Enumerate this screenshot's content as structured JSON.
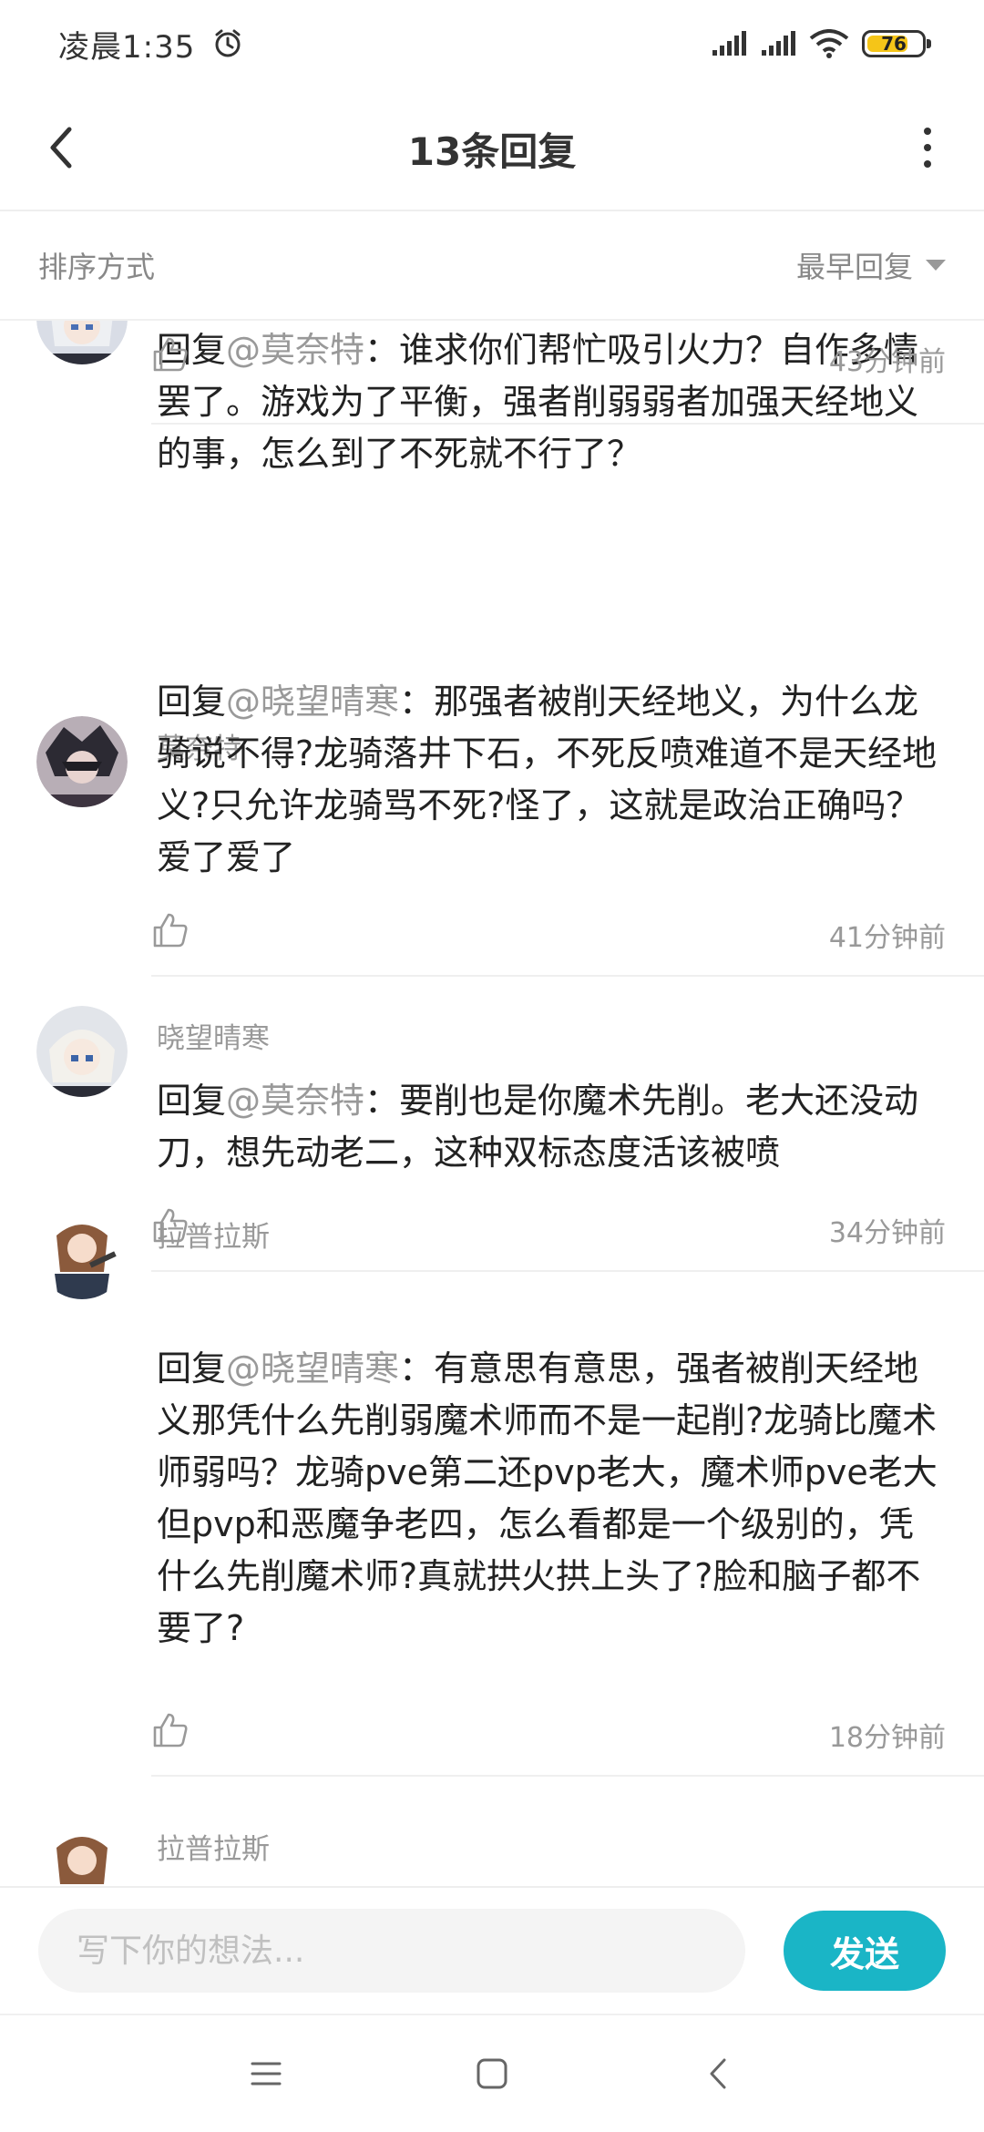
{
  "status_bar": {
    "time": "凌晨1:35",
    "battery": "76",
    "battery_level": 0.76
  },
  "header": {
    "title": "13条回复"
  },
  "sort": {
    "label": "排序方式",
    "selected": "最早回复"
  },
  "replies": [
    {
      "user": "",
      "reply_prefix": "回复",
      "mention": "@莫奈特",
      "text": "：谁求你们帮忙吸引火力？自作多情罢了。游戏为了平衡，强者削弱弱者加强天经地义的事，怎么到了不死就不行了？",
      "time": "43分钟前"
    },
    {
      "user": "莫奈特",
      "reply_prefix": "回复",
      "mention": "@晓望晴寒",
      "text": "：那强者被削天经地义，为什么龙骑说不得?龙骑落井下石，不死反喷难道不是天经地义?只允许龙骑骂不死?怪了，这就是政治正确吗？爱了爱了",
      "time": "41分钟前"
    },
    {
      "user": "晓望晴寒",
      "reply_prefix": "回复",
      "mention": "@莫奈特",
      "text": "：要削也是你魔术先削。老大还没动刀，想先动老二，这种双标态度活该被喷",
      "time": "34分钟前"
    },
    {
      "user": "拉普拉斯",
      "reply_prefix": "回复",
      "mention": "@晓望晴寒",
      "text": "：有意思有意思，强者被削天经地义那凭什么先削弱魔术师而不是一起削?龙骑比魔术师弱吗？龙骑pve第二还pvp老大，魔术师pve老大但pvp和恶魔争老四，怎么看都是一个级别的，凭什么先削魔术师?真就拱火拱上头了?脸和脑子都不要了?",
      "time": "18分钟前"
    },
    {
      "user": "拉普拉斯"
    }
  ],
  "input": {
    "placeholder": "写下你的想法..."
  },
  "send_button": "发送",
  "colors": {
    "accent": "#1ab5c6",
    "battery": "#f5c518"
  },
  "icons": [
    "back-icon",
    "more-icon",
    "thumb-up-icon",
    "menu-icon",
    "home-icon",
    "back-nav-icon"
  ]
}
